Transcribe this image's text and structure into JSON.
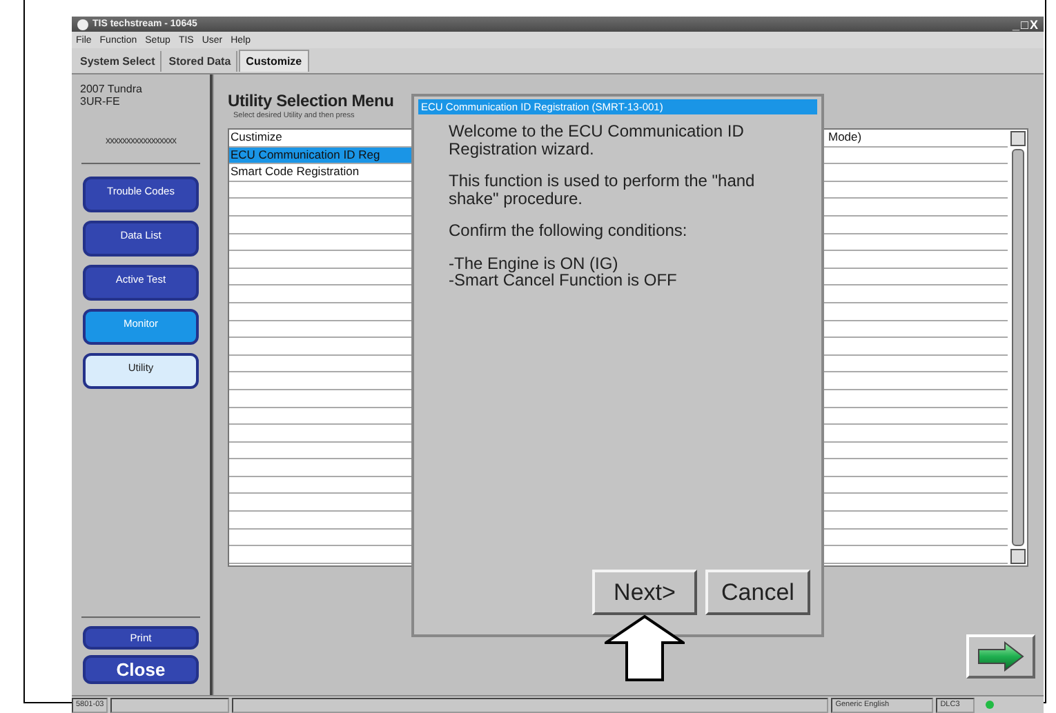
{
  "window": {
    "title": "TIS techstream - 10645",
    "controls": [
      "_",
      "□",
      "X"
    ]
  },
  "menu": [
    "File",
    "Function",
    "Setup",
    "TIS",
    "User",
    "Help"
  ],
  "tabs": [
    {
      "label": "System Select",
      "selected": false
    },
    {
      "label": "Stored Data",
      "selected": false
    },
    {
      "label": "Customize",
      "selected": true
    }
  ],
  "vehicle": {
    "model": "2007 Tundra",
    "engine": "3UR-FE",
    "vin": "xxxxxxxxxxxxxxxxx"
  },
  "sidebar": {
    "buttons": [
      {
        "label": "Trouble Codes",
        "kind": "normal"
      },
      {
        "label": "Data List",
        "kind": "normal"
      },
      {
        "label": "Active Test",
        "kind": "normal"
      },
      {
        "label": "Monitor",
        "kind": "highlight"
      },
      {
        "label": "Utility",
        "kind": "active"
      }
    ],
    "bottom_buttons": [
      {
        "label": "Print",
        "kind": "small"
      },
      {
        "label": "Close",
        "kind": "large"
      }
    ]
  },
  "utility_menu": {
    "title": "Utility Selection Menu",
    "instruction": "Select desired Utility and then press",
    "items": [
      {
        "label": "Custimize",
        "column_2": "Mode)",
        "selected": false
      },
      {
        "label": "ECU Communication ID Reg",
        "selected": true
      },
      {
        "label": "Smart Code Registration",
        "selected": false
      }
    ]
  },
  "dialog": {
    "title": "ECU Communication ID Registration (SMRT-13-001)",
    "paragraphs": [
      "Welcome to the ECU Communication ID Registration wizard.",
      "This function is used to perform the \"hand shake\" procedure.",
      "Confirm the following conditions:",
      "-The Engine is ON (IG)\n-Smart Cancel Function is OFF"
    ],
    "buttons": [
      "Next>",
      "Cancel"
    ]
  },
  "status_bar": {
    "cells": [
      "5801-03",
      "Generic English",
      "DLC3"
    ],
    "connected": true
  }
}
